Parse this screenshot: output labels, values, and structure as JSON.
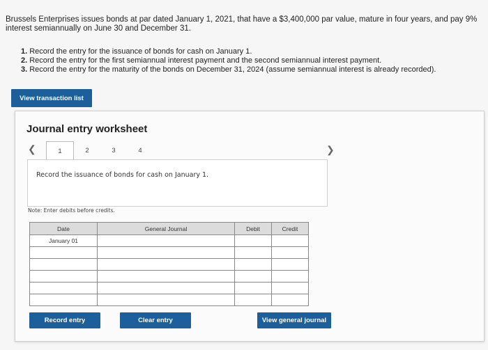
{
  "intro": "Brussels Enterprises issues bonds at par dated January 1, 2021, that have a $3,400,000 par value, mature in four years, and pay 9% interest semiannually on June 30 and December 31.",
  "requirements": [
    {
      "num": "1.",
      "text": "Record the entry for the issuance of bonds for cash on January 1."
    },
    {
      "num": "2.",
      "text": "Record the entry for the first semiannual interest payment and the second semiannual interest payment."
    },
    {
      "num": "3.",
      "text": "Record the entry for the maturity of the bonds on December 31, 2024 (assume semiannual interest is already recorded)."
    }
  ],
  "view_transaction_list_label": "View transaction list",
  "worksheet": {
    "title": "Journal entry worksheet",
    "prev_icon": "chevron-left-icon",
    "next_icon": "chevron-right-icon",
    "steps": [
      "1",
      "2",
      "3",
      "4"
    ],
    "active_step": "1",
    "instruction": "Record the issuance of bonds for cash on January 1.",
    "note": "Note: Enter debits before credits.",
    "table": {
      "headers": {
        "date": "Date",
        "general_journal": "General Journal",
        "debit": "Debit",
        "credit": "Credit"
      },
      "rows": [
        {
          "date": "January 01",
          "account": "",
          "debit": "",
          "credit": ""
        },
        {
          "date": "",
          "account": "",
          "debit": "",
          "credit": ""
        },
        {
          "date": "",
          "account": "",
          "debit": "",
          "credit": ""
        },
        {
          "date": "",
          "account": "",
          "debit": "",
          "credit": ""
        },
        {
          "date": "",
          "account": "",
          "debit": "",
          "credit": ""
        },
        {
          "date": "",
          "account": "",
          "debit": "",
          "credit": ""
        }
      ]
    },
    "buttons": {
      "record": "Record entry",
      "clear": "Clear entry",
      "view_journal": "View general journal"
    }
  },
  "colors": {
    "button_blue": "#1d5f9b",
    "header_gray": "#dcdcdc"
  }
}
